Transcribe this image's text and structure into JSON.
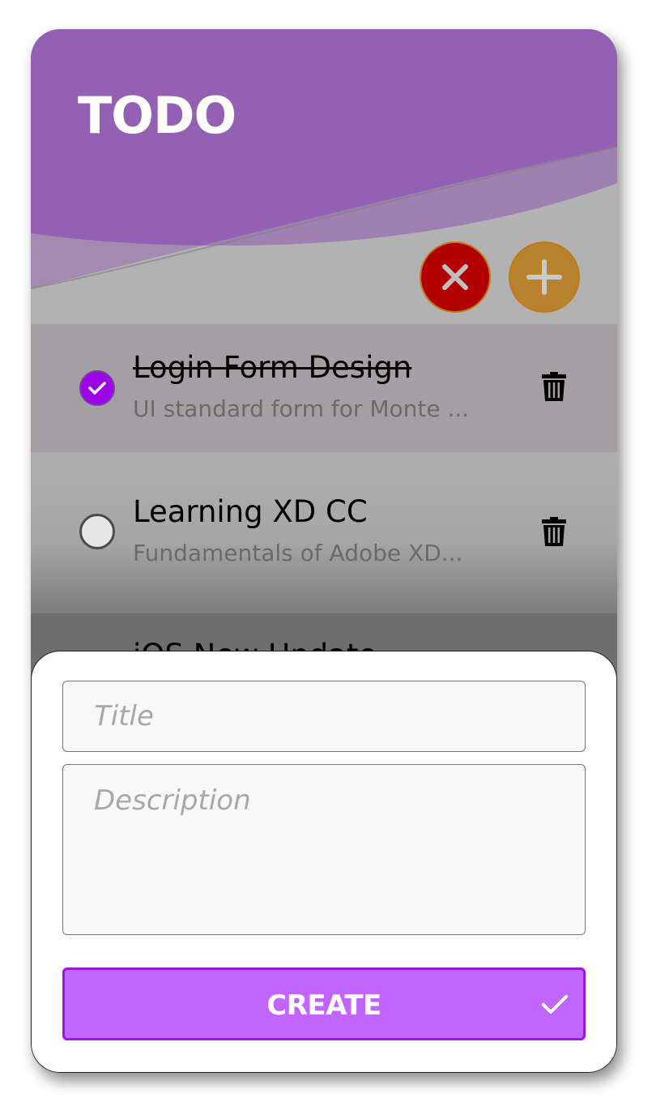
{
  "app": {
    "title": "TODO",
    "accent_color": "#9360b3",
    "create_color": "#c264fe"
  },
  "header_actions": {
    "clear_icon": "close-icon",
    "add_icon": "plus-icon"
  },
  "todos": [
    {
      "title": "Login Form Design",
      "description": "UI standard form for Monte ...",
      "completed": true
    },
    {
      "title": "Learning XD CC",
      "description": "Fundamentals of Adobe XD...",
      "completed": false
    },
    {
      "title": "iOS New Update",
      "completed": false
    }
  ],
  "form": {
    "title_placeholder": "Title",
    "description_placeholder": "Description",
    "create_label": "CREATE"
  }
}
